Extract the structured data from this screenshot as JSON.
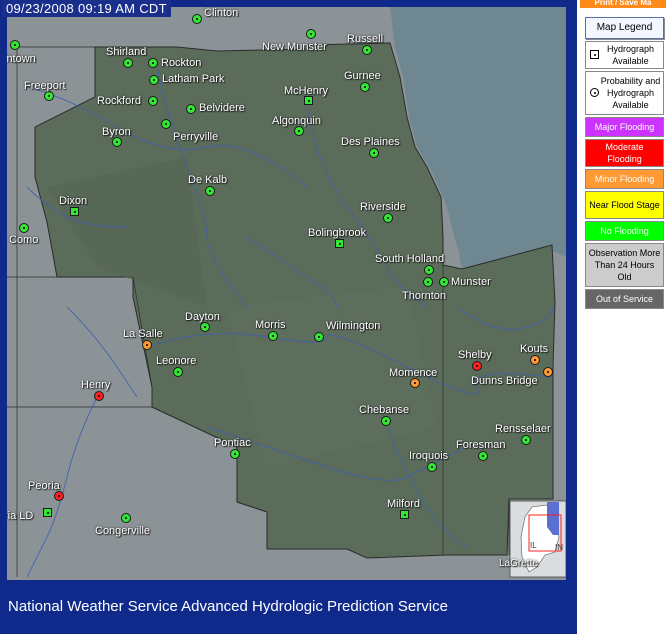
{
  "timestamp": "09/23/2008 09:19 AM CDT",
  "footer": "National Weather Service Advanced Hydrologic Prediction Service",
  "print_button": "Print / Save Ma",
  "legend": {
    "title": "Map Legend",
    "items": [
      {
        "label": "Hydrograph Available",
        "bg": "#ffffff",
        "fg": "#000000",
        "icon": "square"
      },
      {
        "label": "Probability and Hydrograph Available",
        "bg": "#ffffff",
        "fg": "#000000",
        "icon": "circle"
      },
      {
        "label": "Major Flooding",
        "bg": "#cc33ff",
        "fg": "#ffffff",
        "icon": ""
      },
      {
        "label": "Moderate Flooding",
        "bg": "#ff0000",
        "fg": "#ffffff",
        "icon": ""
      },
      {
        "label": "Minor Flooding",
        "bg": "#ff9933",
        "fg": "#ffffff",
        "icon": ""
      },
      {
        "label": "Near Flood Stage",
        "bg": "#ffff00",
        "fg": "#000000",
        "icon": ""
      },
      {
        "label": "No Flooding",
        "bg": "#00ff00",
        "fg": "#ffffff",
        "icon": ""
      },
      {
        "label": "Observation More Than 24 Hours Old",
        "bg": "#cccccc",
        "fg": "#000000",
        "icon": ""
      },
      {
        "label": "Out of Service",
        "bg": "#666666",
        "fg": "#ffffff",
        "icon": ""
      }
    ]
  },
  "status_colors": {
    "no_flooding": "#33e633",
    "minor": "#ff9933",
    "moderate": "#ff2020",
    "major": "#cc33ff"
  },
  "gauges": [
    {
      "name": "Clinton",
      "status": "no_flooding",
      "shape": "circle"
    },
    {
      "name": "intown",
      "status": "no_flooding",
      "shape": "circle"
    },
    {
      "name": "Shirland",
      "status": "no_flooding",
      "shape": "circle"
    },
    {
      "name": "Rockton",
      "status": "no_flooding",
      "shape": "circle"
    },
    {
      "name": "New Munster",
      "status": "no_flooding",
      "shape": "circle"
    },
    {
      "name": "Russell",
      "status": "no_flooding",
      "shape": "circle"
    },
    {
      "name": "Latham Park",
      "status": "no_flooding",
      "shape": "circle"
    },
    {
      "name": "Freeport",
      "status": "no_flooding",
      "shape": "circle"
    },
    {
      "name": "Gurnee",
      "status": "no_flooding",
      "shape": "circle"
    },
    {
      "name": "McHenry",
      "status": "no_flooding",
      "shape": "square"
    },
    {
      "name": "Rockford",
      "status": "no_flooding",
      "shape": "circle"
    },
    {
      "name": "Belvidere",
      "status": "no_flooding",
      "shape": "circle"
    },
    {
      "name": "Algonquin",
      "status": "no_flooding",
      "shape": "circle"
    },
    {
      "name": "Byron",
      "status": "no_flooding",
      "shape": "circle"
    },
    {
      "name": "Perryville",
      "status": "no_flooding",
      "shape": "circle"
    },
    {
      "name": "Des Plaines",
      "status": "no_flooding",
      "shape": "circle"
    },
    {
      "name": "De Kalb",
      "status": "no_flooding",
      "shape": "circle"
    },
    {
      "name": "Dixon",
      "status": "no_flooding",
      "shape": "square"
    },
    {
      "name": "Riverside",
      "status": "no_flooding",
      "shape": "circle"
    },
    {
      "name": "Como",
      "status": "no_flooding",
      "shape": "circle"
    },
    {
      "name": "Bolingbrook",
      "status": "no_flooding",
      "shape": "square"
    },
    {
      "name": "South Holland",
      "status": "no_flooding",
      "shape": "circle"
    },
    {
      "name": "Munster",
      "status": "no_flooding",
      "shape": "circle"
    },
    {
      "name": "Thornton",
      "status": "no_flooding",
      "shape": "circle"
    },
    {
      "name": "Dayton",
      "status": "no_flooding",
      "shape": "circle"
    },
    {
      "name": "La Salle",
      "status": "minor",
      "shape": "circle"
    },
    {
      "name": "Morris",
      "status": "no_flooding",
      "shape": "circle"
    },
    {
      "name": "Wilmington",
      "status": "no_flooding",
      "shape": "circle"
    },
    {
      "name": "Shelby",
      "status": "moderate",
      "shape": "circle"
    },
    {
      "name": "Kouts",
      "status": "minor",
      "shape": "circle"
    },
    {
      "name": "Leonore",
      "status": "no_flooding",
      "shape": "circle"
    },
    {
      "name": "Momence",
      "status": "minor",
      "shape": "circle"
    },
    {
      "name": "Dunns Bridge",
      "status": "minor",
      "shape": "circle"
    },
    {
      "name": "Henry",
      "status": "moderate",
      "shape": "circle"
    },
    {
      "name": "Chebanse",
      "status": "no_flooding",
      "shape": "circle"
    },
    {
      "name": "Rensselaer",
      "status": "no_flooding",
      "shape": "circle"
    },
    {
      "name": "Pontiac",
      "status": "no_flooding",
      "shape": "circle"
    },
    {
      "name": "Foresman",
      "status": "no_flooding",
      "shape": "circle"
    },
    {
      "name": "Iroquois",
      "status": "no_flooding",
      "shape": "circle"
    },
    {
      "name": "Peoria",
      "status": "moderate",
      "shape": "circle"
    },
    {
      "name": "ria LD",
      "status": "no_flooding",
      "shape": "square"
    },
    {
      "name": "Milford",
      "status": "no_flooding",
      "shape": "square"
    },
    {
      "name": "Congerville",
      "status": "no_flooding",
      "shape": "circle"
    }
  ],
  "inset_map": {
    "labels": [
      "IL",
      "IN",
      "LaGrette"
    ]
  }
}
